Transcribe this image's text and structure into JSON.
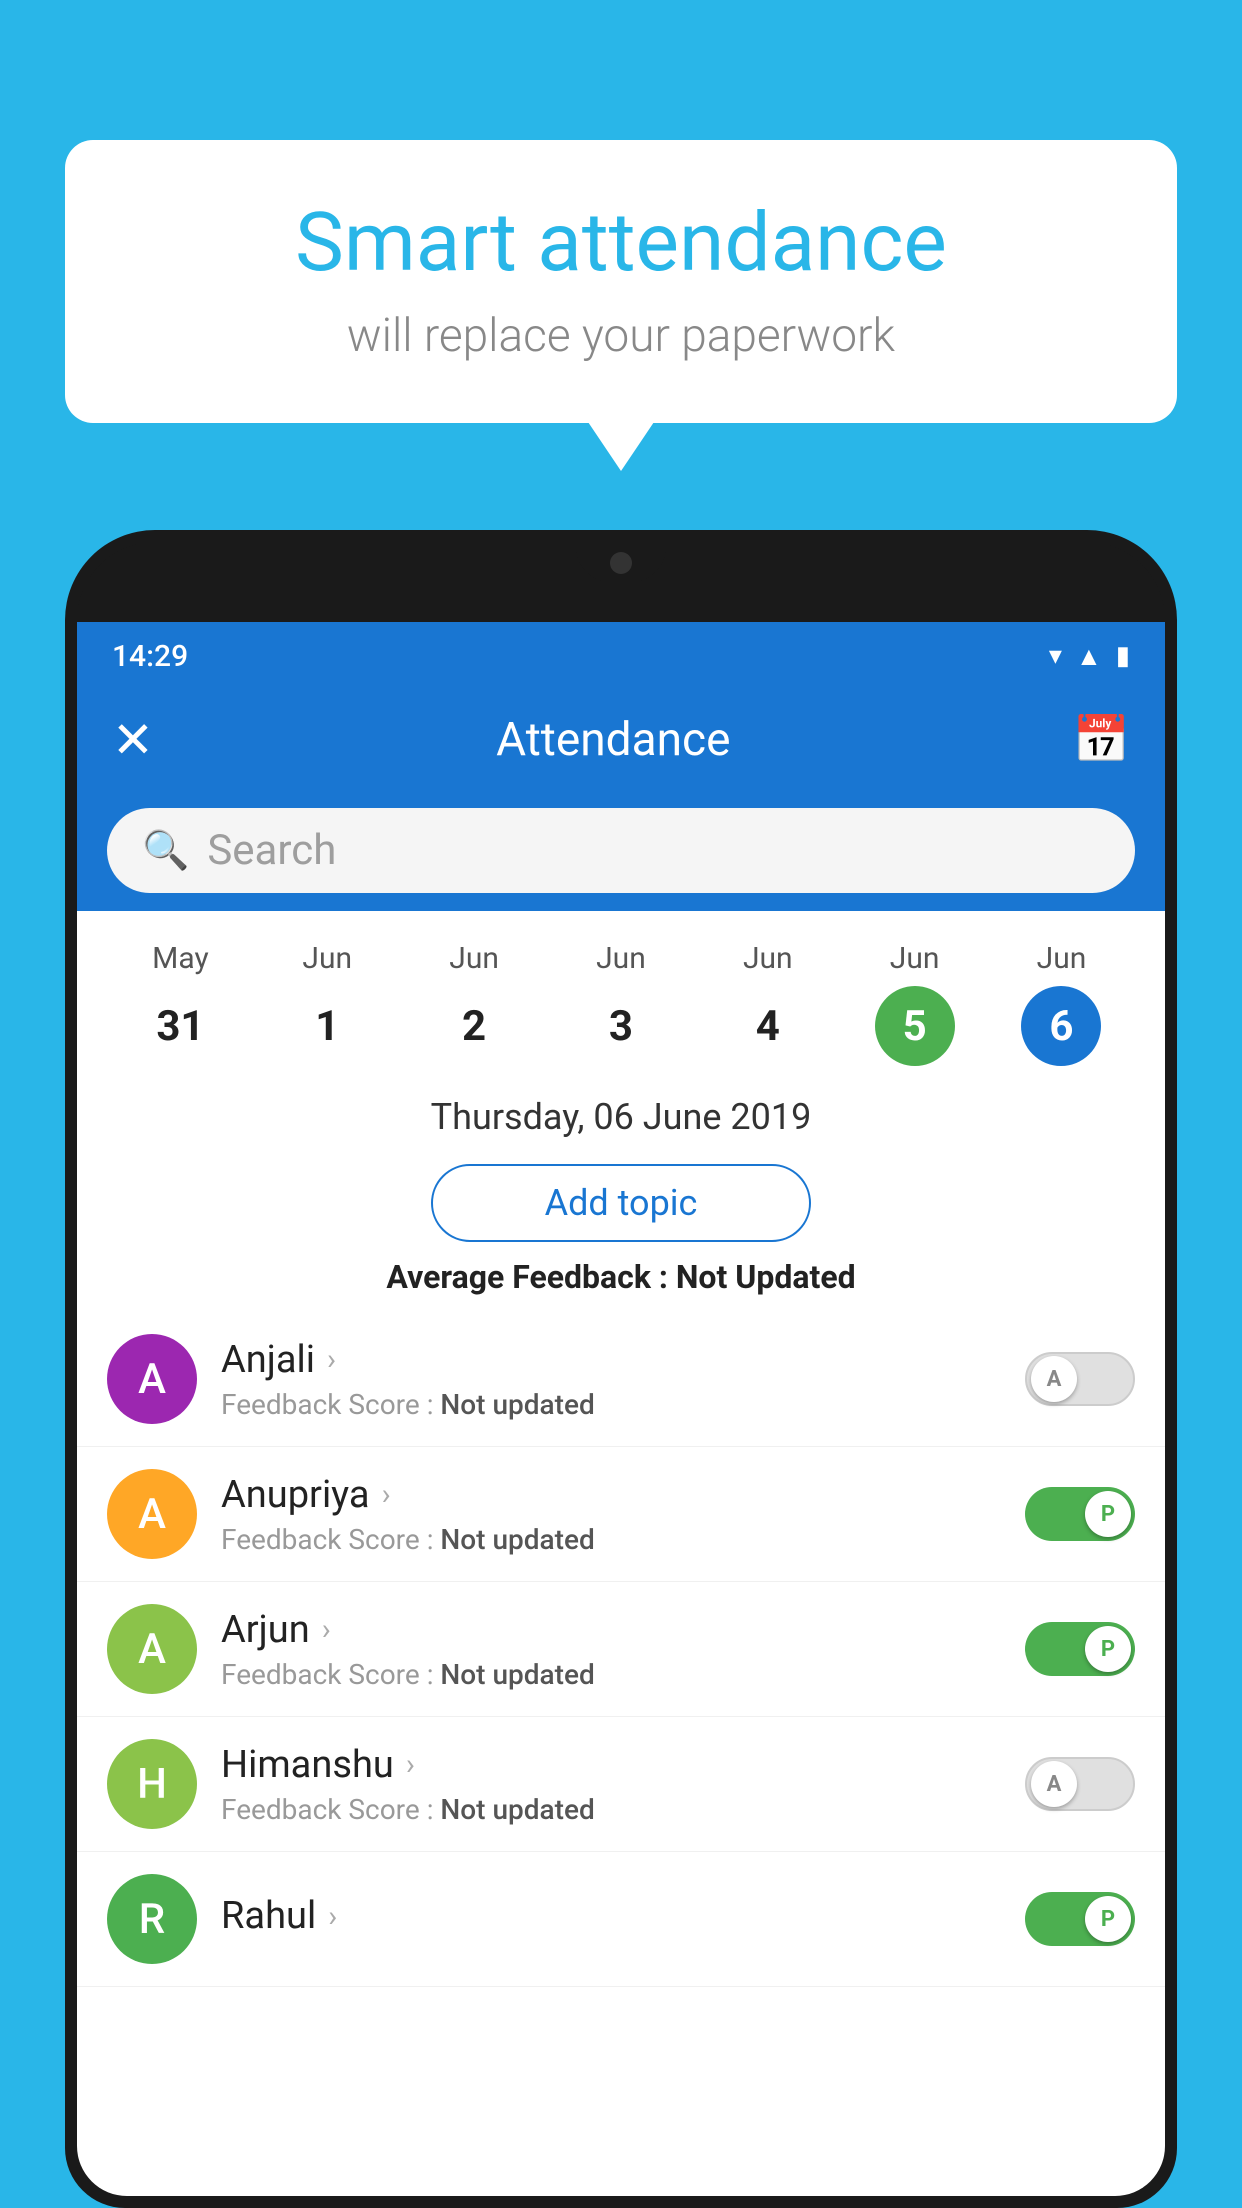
{
  "background_color": "#29b6e8",
  "speech_bubble": {
    "title": "Smart attendance",
    "subtitle": "will replace your paperwork"
  },
  "status_bar": {
    "time": "14:29",
    "icons": [
      "wifi",
      "signal",
      "battery"
    ]
  },
  "app_bar": {
    "title": "Attendance",
    "close_icon": "✕",
    "calendar_icon": "📅"
  },
  "search": {
    "placeholder": "Search"
  },
  "calendar": {
    "days": [
      {
        "month": "May",
        "date": "31",
        "highlight": "none"
      },
      {
        "month": "Jun",
        "date": "1",
        "highlight": "none"
      },
      {
        "month": "Jun",
        "date": "2",
        "highlight": "none"
      },
      {
        "month": "Jun",
        "date": "3",
        "highlight": "none"
      },
      {
        "month": "Jun",
        "date": "4",
        "highlight": "none"
      },
      {
        "month": "Jun",
        "date": "5",
        "highlight": "green"
      },
      {
        "month": "Jun",
        "date": "6",
        "highlight": "blue"
      }
    ],
    "selected_date": "Thursday, 06 June 2019"
  },
  "add_topic_label": "Add topic",
  "avg_feedback": {
    "label": "Average Feedback : ",
    "value": "Not Updated"
  },
  "students": [
    {
      "name": "Anjali",
      "avatar_letter": "A",
      "avatar_color": "#9c27b0",
      "feedback": "Feedback Score : ",
      "feedback_value": "Not updated",
      "toggle": "off",
      "toggle_label": "A"
    },
    {
      "name": "Anupriya",
      "avatar_letter": "A",
      "avatar_color": "#ffa726",
      "feedback": "Feedback Score : ",
      "feedback_value": "Not updated",
      "toggle": "on",
      "toggle_label": "P"
    },
    {
      "name": "Arjun",
      "avatar_letter": "A",
      "avatar_color": "#8bc34a",
      "feedback": "Feedback Score : ",
      "feedback_value": "Not updated",
      "toggle": "on",
      "toggle_label": "P"
    },
    {
      "name": "Himanshu",
      "avatar_letter": "H",
      "avatar_color": "#8bc34a",
      "feedback": "Feedback Score : ",
      "feedback_value": "Not updated",
      "toggle": "off",
      "toggle_label": "A"
    },
    {
      "name": "Rahul",
      "avatar_letter": "R",
      "avatar_color": "#4caf50",
      "feedback": "",
      "feedback_value": "",
      "toggle": "on",
      "toggle_label": "P"
    }
  ]
}
